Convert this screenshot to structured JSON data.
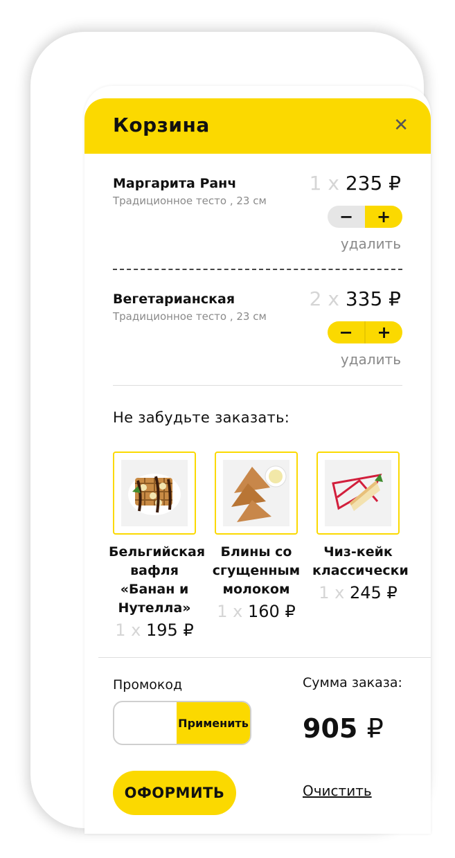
{
  "cart": {
    "title": "Корзина",
    "close_icon": "close-icon"
  },
  "items": [
    {
      "name": "Маргарита Ранч",
      "desc": "Традиционное тесто , 23 см",
      "qty": "1 x",
      "price": "235",
      "currency": "₽",
      "minus": "−",
      "plus": "+",
      "delete": "удалить"
    },
    {
      "name": "Вегетарианская",
      "desc": "Традиционное тесто , 23 см",
      "qty": "2 x",
      "price": "335",
      "currency": "₽",
      "minus": "−",
      "plus": "+",
      "delete": "удалить"
    }
  ],
  "upsell": {
    "title": "Не забудьте заказать:",
    "products": [
      {
        "name": "Бельгийская вафля «Банан и Нутелла»",
        "qty": "1 x",
        "price": "195",
        "currency": "₽",
        "image": "waffle-image"
      },
      {
        "name": "Блины со сгущенным молоком",
        "qty": "1 x",
        "price": "160",
        "currency": "₽",
        "image": "pancakes-image"
      },
      {
        "name": "Чиз-кейк классически",
        "qty": "1 x",
        "price": "245",
        "currency": "₽",
        "image": "cheesecake-image"
      }
    ]
  },
  "footer": {
    "promo_label": "Промокод",
    "promo_value": "",
    "apply_label": "Применить",
    "sum_label": "Сумма заказа:",
    "sum_value": "905",
    "currency": "₽",
    "checkout_label": "ОФОРМИТЬ",
    "clear_label": "Очистить"
  },
  "colors": {
    "accent": "#fbd900",
    "muted": "#8a8a8a",
    "qty": "#d5d5d5"
  }
}
